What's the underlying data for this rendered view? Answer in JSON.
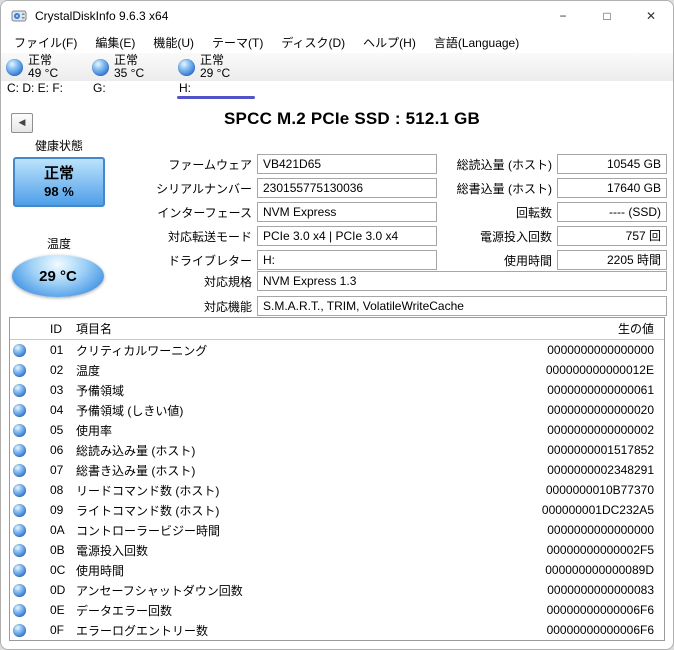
{
  "window": {
    "title": "CrystalDiskInfo 9.6.3 x64"
  },
  "icons": {
    "back": "◀",
    "minimize": "−",
    "maximize": "□",
    "close": "✕"
  },
  "colors": {
    "accent": "#5353c9",
    "health_border": "#4488cc",
    "health_top": "#bce3fc",
    "health_bottom": "#4f9fe8",
    "orb_dark": "#1c55ae"
  },
  "menu": {
    "items": [
      {
        "label": "ファイル(F)",
        "name": "menu-file"
      },
      {
        "label": "編集(E)",
        "name": "menu-edit"
      },
      {
        "label": "機能(U)",
        "name": "menu-function"
      },
      {
        "label": "テーマ(T)",
        "name": "menu-theme"
      },
      {
        "label": "ディスク(D)",
        "name": "menu-disk"
      },
      {
        "label": "ヘルプ(H)",
        "name": "menu-help"
      },
      {
        "label": "言語(Language)",
        "name": "menu-language"
      }
    ]
  },
  "drive_tabs": [
    {
      "status": "正常",
      "temp": "49 °C",
      "letters": "C: D: E: F:",
      "selected": false,
      "name": "drive-tab-cdef"
    },
    {
      "status": "正常",
      "temp": "35 °C",
      "letters": "G:",
      "selected": false,
      "name": "drive-tab-g"
    },
    {
      "status": "正常",
      "temp": "29 °C",
      "letters": "H:",
      "selected": true,
      "name": "drive-tab-h"
    }
  ],
  "main": {
    "title": "SPCC M.2 PCIe SSD : 512.1 GB",
    "health": {
      "label": "健康状態",
      "status": "正常",
      "percent": "98 %"
    },
    "temperature": {
      "label": "温度",
      "value": "29 °C"
    },
    "fields_left": [
      {
        "label": "ファームウェア",
        "value": "VB421D65"
      },
      {
        "label": "シリアルナンバー",
        "value": "230155775130036"
      },
      {
        "label": "インターフェース",
        "value": "NVM Express"
      },
      {
        "label": "対応転送モード",
        "value": "PCIe 3.0 x4 | PCIe 3.0 x4"
      },
      {
        "label": "ドライブレター",
        "value": "H:"
      }
    ],
    "fields_right": [
      {
        "label": "総読込量 (ホスト)",
        "value": "10545 GB"
      },
      {
        "label": "総書込量 (ホスト)",
        "value": "17640 GB"
      },
      {
        "label": "回転数",
        "value": "---- (SSD)"
      },
      {
        "label": "電源投入回数",
        "value": "757 回"
      },
      {
        "label": "使用時間",
        "value": "2205 時間"
      }
    ],
    "fields_wide": [
      {
        "label": "対応規格",
        "value": "NVM Express 1.3"
      },
      {
        "label": "対応機能",
        "value": "S.M.A.R.T., TRIM, VolatileWriteCache"
      }
    ]
  },
  "smart_table": {
    "headers": {
      "id": "ID",
      "name": "項目名",
      "raw": "生の値"
    },
    "rows": [
      {
        "id": "01",
        "name": "クリティカルワーニング",
        "raw": "0000000000000000"
      },
      {
        "id": "02",
        "name": "温度",
        "raw": "000000000000012E"
      },
      {
        "id": "03",
        "name": "予備領域",
        "raw": "0000000000000061"
      },
      {
        "id": "04",
        "name": "予備領域 (しきい値)",
        "raw": "0000000000000020"
      },
      {
        "id": "05",
        "name": "使用率",
        "raw": "0000000000000002"
      },
      {
        "id": "06",
        "name": "総読み込み量 (ホスト)",
        "raw": "0000000001517852"
      },
      {
        "id": "07",
        "name": "総書き込み量 (ホスト)",
        "raw": "0000000002348291"
      },
      {
        "id": "08",
        "name": "リードコマンド数 (ホスト)",
        "raw": "0000000010B77370"
      },
      {
        "id": "09",
        "name": "ライトコマンド数 (ホスト)",
        "raw": "000000001DC232A5"
      },
      {
        "id": "0A",
        "name": "コントローラービジー時間",
        "raw": "0000000000000000"
      },
      {
        "id": "0B",
        "name": "電源投入回数",
        "raw": "00000000000002F5"
      },
      {
        "id": "0C",
        "name": "使用時間",
        "raw": "000000000000089D"
      },
      {
        "id": "0D",
        "name": "アンセーフシャットダウン回数",
        "raw": "0000000000000083"
      },
      {
        "id": "0E",
        "name": "データエラー回数",
        "raw": "00000000000006F6"
      },
      {
        "id": "0F",
        "name": "エラーログエントリー数",
        "raw": "00000000000006F6"
      }
    ]
  }
}
